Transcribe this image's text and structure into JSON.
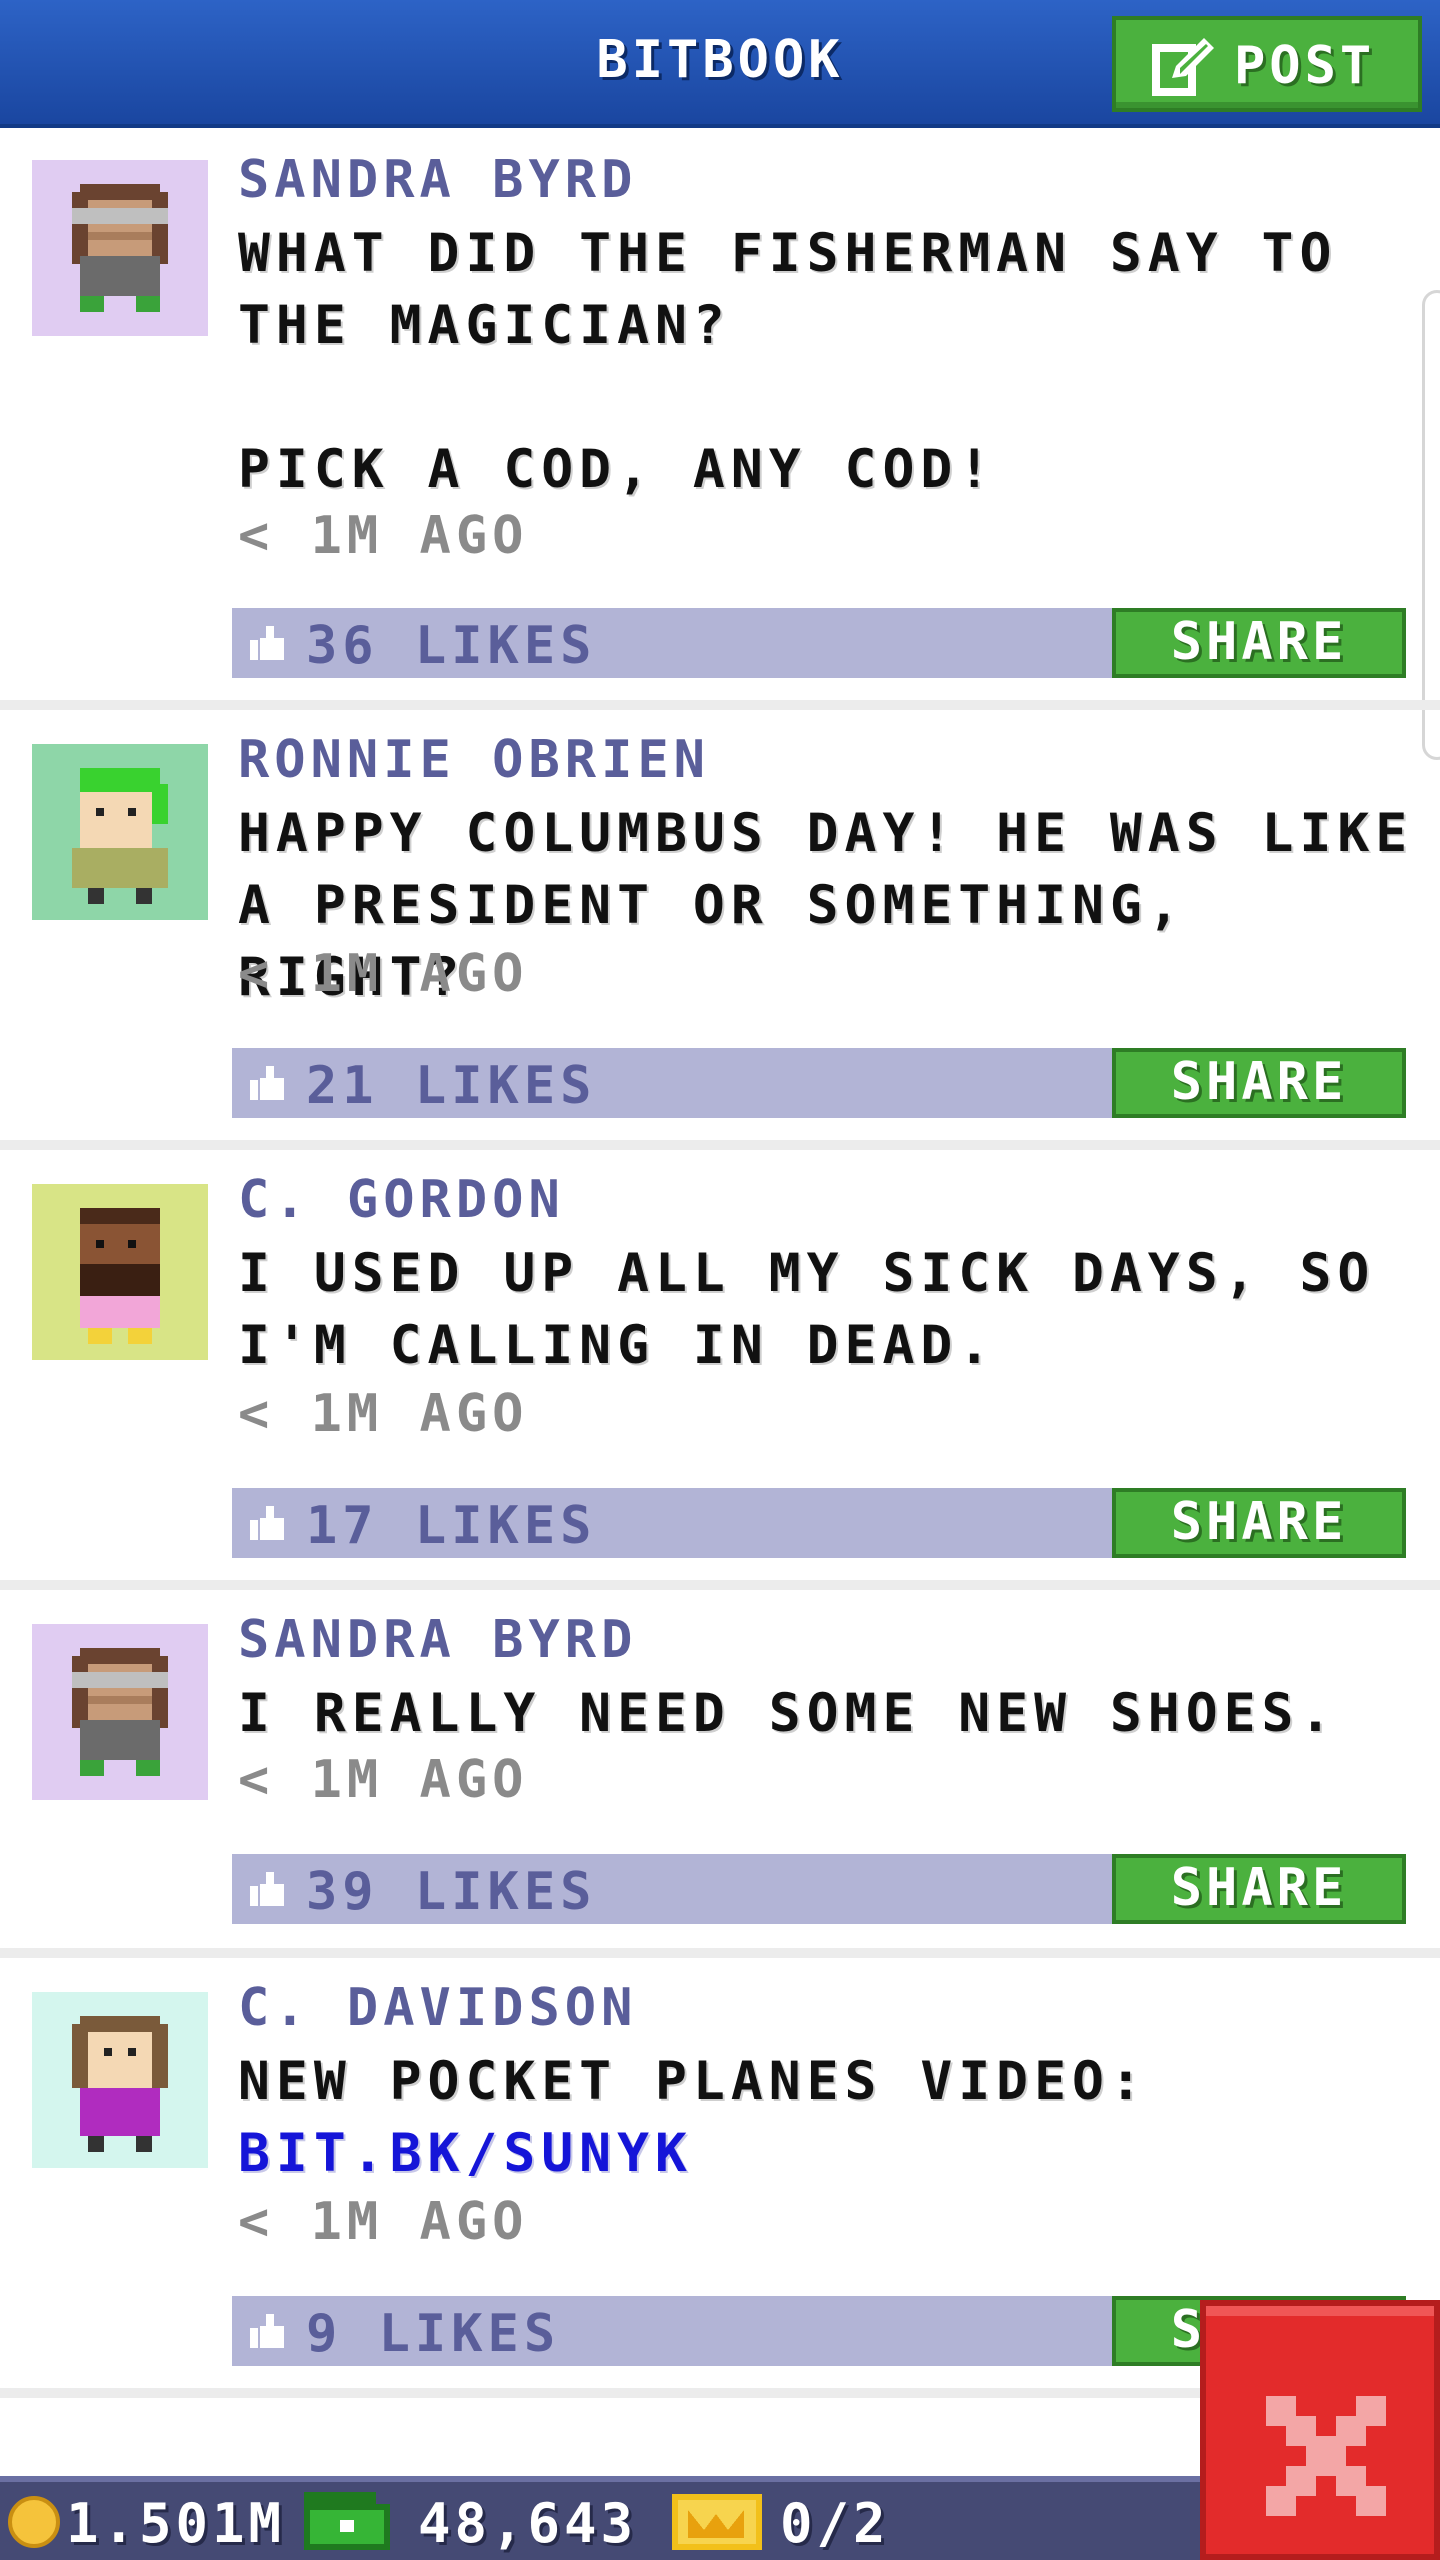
{
  "header": {
    "title": "BITBOOK",
    "post_label": "POST"
  },
  "posts": [
    {
      "author": "SANDRA BYRD",
      "text": "WHAT DID THE FISHERMAN SAY TO THE MAGICIAN?\n\nPICK A COD, ANY COD!",
      "link": "",
      "time": "< 1M AGO",
      "likes": "36 LIKES",
      "share": "SHARE",
      "avatar_color": "#e0ccf2"
    },
    {
      "author": "RONNIE OBRIEN",
      "text": "HAPPY COLUMBUS DAY! HE WAS LIKE A PRESIDENT OR SOMETHING, RIGHT?",
      "link": "",
      "time": "< 1M AGO",
      "likes": "21 LIKES",
      "share": "SHARE",
      "avatar_color": "#8ed6a8"
    },
    {
      "author": "C. GORDON",
      "text": "I USED UP ALL MY SICK DAYS, SO I'M CALLING IN DEAD.",
      "link": "",
      "time": "< 1M AGO",
      "likes": "17 LIKES",
      "share": "SHARE",
      "avatar_color": "#d8e486"
    },
    {
      "author": "SANDRA BYRD",
      "text": "I REALLY NEED SOME NEW SHOES.",
      "link": "",
      "time": "< 1M AGO",
      "likes": "39 LIKES",
      "share": "SHARE",
      "avatar_color": "#e0ccf2"
    },
    {
      "author": "C. DAVIDSON",
      "text": "NEW POCKET PLANES VIDEO:",
      "link": "BIT.BK/SUNYK",
      "time": "< 1M AGO",
      "likes": "9 LIKES",
      "share": "SHARE",
      "avatar_color": "#d4f6ee"
    }
  ],
  "status": {
    "coins": "1.501M",
    "bux": "48,643",
    "tickets": "0/2"
  },
  "colors": {
    "header": "#2d63c6",
    "accent_green": "#4bb13e",
    "like_bar": "#b2b4d6",
    "close": "#e32b2b"
  }
}
